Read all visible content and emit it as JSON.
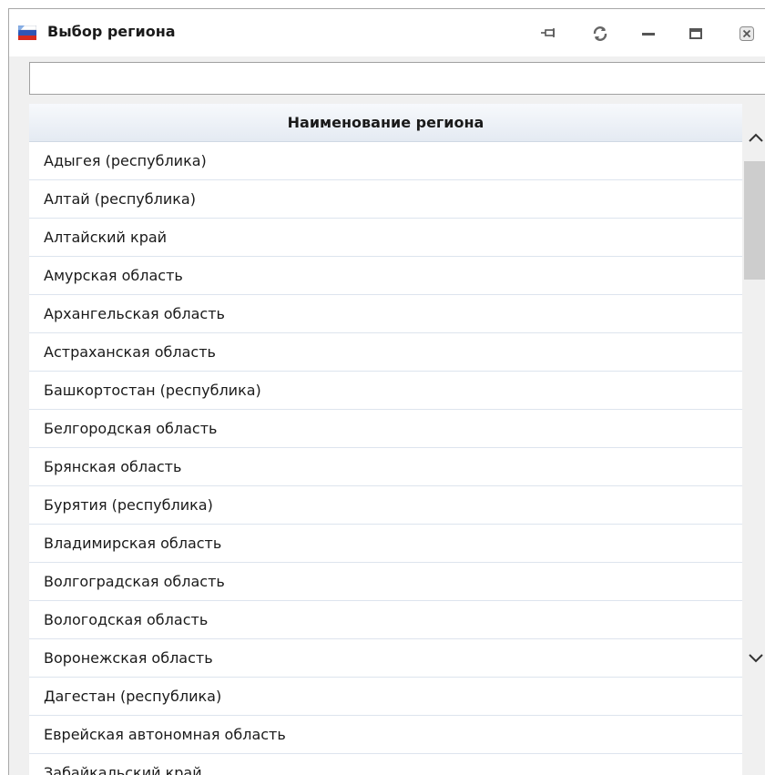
{
  "window": {
    "title": "Выбор региона"
  },
  "titlebar_buttons": [
    {
      "name": "pin-button",
      "icon": "pin-icon"
    },
    {
      "name": "refresh-button",
      "icon": "refresh-icon"
    },
    {
      "name": "minimize-button",
      "icon": "minimize-icon"
    },
    {
      "name": "maximize-button",
      "icon": "maximize-icon"
    },
    {
      "name": "close-button",
      "icon": "close-icon"
    }
  ],
  "search": {
    "value": "",
    "placeholder": ""
  },
  "grid": {
    "column_header": "Наименование региона",
    "rows": [
      "Адыгея (республика)",
      "Алтай (республика)",
      "Алтайский край",
      "Амурская область",
      "Архангельская область",
      "Астраханская область",
      "Башкортостан (республика)",
      "Белгородская область",
      "Брянская область",
      "Бурятия (республика)",
      "Владимирская область",
      "Волгоградская область",
      "Вологодская область",
      "Воронежская область",
      "Дагестан (республика)",
      "Еврейская автономная область",
      "Забайкальский край"
    ]
  },
  "colors": {
    "window_bg": "#f0f0f0",
    "header_gradient_top": "#f7f9fc",
    "header_gradient_bottom": "#e4eaf2",
    "row_divider": "#dde4ee",
    "scroll_thumb": "#cdcdcd"
  }
}
